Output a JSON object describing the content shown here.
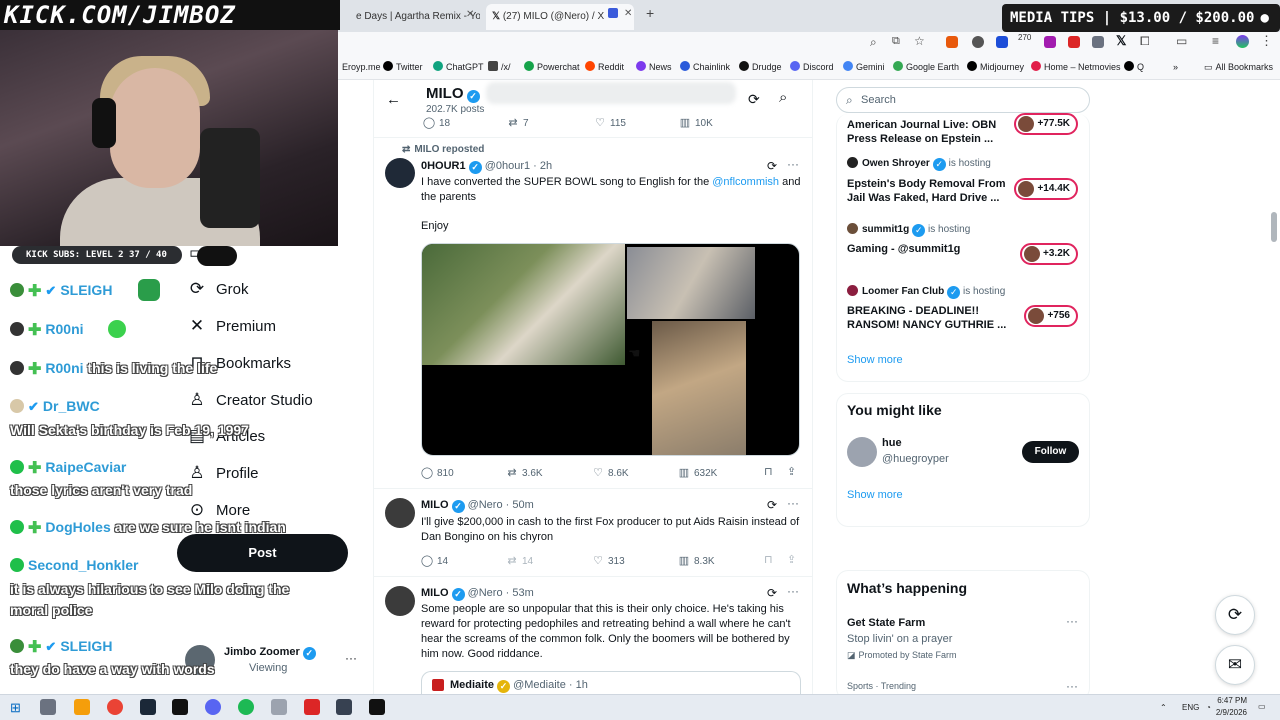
{
  "browser": {
    "tabs": [
      {
        "label": "e Days | Agartha Remix - You"
      },
      {
        "label": "(27) MILO (@Nero) / X",
        "active": true
      }
    ],
    "toolbar_badge": "270",
    "bookmarks": [
      {
        "label": "Eroyp.me",
        "color": "#999999"
      },
      {
        "label": "Twitter",
        "color": "#000000"
      },
      {
        "label": "ChatGPT",
        "color": "#10a37f"
      },
      {
        "label": "/x/",
        "color": "#444444"
      },
      {
        "label": "Powerchat",
        "color": "#16a34a"
      },
      {
        "label": "Reddit",
        "color": "#ff4500"
      },
      {
        "label": "News",
        "color": "#7c3aed"
      },
      {
        "label": "Chainlink",
        "color": "#2a5ada"
      },
      {
        "label": "Drudge",
        "color": "#111111"
      },
      {
        "label": "Discord",
        "color": "#5865f2"
      },
      {
        "label": "Gemini",
        "color": "#4285f4"
      },
      {
        "label": "Google Earth",
        "color": "#34a853"
      },
      {
        "label": "Midjourney",
        "color": "#000000"
      },
      {
        "label": "Home – Netmovies",
        "color": "#e11d48"
      },
      {
        "label": "Q",
        "color": "#000000"
      },
      {
        "label": "»",
        "color": "transparent"
      },
      {
        "label": "All Bookmarks",
        "color": "transparent"
      }
    ]
  },
  "overlay": {
    "stream_logo": "KICK.COM/JIMBOZ",
    "media_tips": "MEDIA TIPS | $13.00 / $200.00",
    "kick_subs": "KICK SUBS: LEVEL 2 37 / 40",
    "chat": [
      {
        "user": "SLEIGH",
        "message": "",
        "badge_color": "#3a8e3a"
      },
      {
        "user": "R00ni",
        "message": "",
        "badge_color": "#333333"
      },
      {
        "user": "R00ni",
        "message": "this is living the life",
        "badge_color": "#333333"
      },
      {
        "user": "Dr_BWC",
        "message": "",
        "badge_color": "#d8c8a8"
      },
      {
        "user": "",
        "message": "Will Sekta's birthday is Feb 19, 1997",
        "badge_color": ""
      },
      {
        "user": "RaipeCaviar",
        "message": "",
        "badge_color": "#1fbf4a"
      },
      {
        "user": "",
        "message": "those lyrics aren't very trad",
        "badge_color": ""
      },
      {
        "user": "DogHoles",
        "message": "are we sure he isnt indian",
        "badge_color": "#1fbf4a"
      },
      {
        "user": "Second_Honkler",
        "message": "",
        "badge_color": "#1fbf4a"
      },
      {
        "user": "",
        "message": "it is always hilarious to see Milo doing the",
        "badge_color": ""
      },
      {
        "user": "",
        "message": "moral police",
        "badge_color": ""
      },
      {
        "user": "SLEIGH",
        "message": "",
        "badge_color": "#3a8e3a"
      },
      {
        "user": "",
        "message": "they do have a way with words",
        "badge_color": ""
      }
    ]
  },
  "x_nav": {
    "items": [
      {
        "label": "at",
        "icon": "chat-icon"
      },
      {
        "label": "Grok",
        "icon": "grok-icon"
      },
      {
        "label": "Premium",
        "icon": "x-logo-icon"
      },
      {
        "label": "Bookmarks",
        "icon": "bookmark-icon"
      },
      {
        "label": "Creator Studio",
        "icon": "creator-studio-icon"
      },
      {
        "label": "Articles",
        "icon": "articles-icon"
      },
      {
        "label": "Profile",
        "icon": "profile-icon"
      },
      {
        "label": "More",
        "icon": "more-icon"
      }
    ],
    "post_label": "Post",
    "account": {
      "name": "Jimbo Zoomer",
      "sub": "Viewing"
    }
  },
  "profile_header": {
    "name": "MILO",
    "posts": "202.7K posts"
  },
  "tweets": [
    {
      "stats": {
        "replies": "18",
        "reposts": "7",
        "likes": "115",
        "views": "10K"
      }
    },
    {
      "repost_label": "MILO reposted",
      "name": "0HOUR1",
      "handle": "@0hour1",
      "time": "2h",
      "text_before": "I have converted the SUPER BOWL song to English for the ",
      "mention": "@nflcommish",
      "text_after": " and the parents",
      "text2": "Enjoy",
      "stats": {
        "replies": "810",
        "reposts": "3.6K",
        "likes": "8.6K",
        "views": "632K"
      }
    },
    {
      "name": "MILO",
      "handle": "@Nero",
      "time": "50m",
      "text": "I'll give $200,000 in cash to the first Fox producer to put Aids Raisin instead of Dan Bongino on his chyron",
      "stats": {
        "replies": "14",
        "reposts": "14",
        "likes": "313",
        "views": "8.3K"
      }
    },
    {
      "name": "MILO",
      "handle": "@Nero",
      "time": "53m",
      "text": "Some people are so unpopular that this is their only choice. He's taking his reward for protecting pedophiles and retreating behind a wall where he can't hear the screams of the common folk. Only the boomers will be bothered by him now. Good riddance.",
      "quote": {
        "name": "Mediaite",
        "handle": "@Mediaite",
        "time": "1h"
      }
    }
  ],
  "sidebar": {
    "search_placeholder": "Search",
    "spaces": [
      {
        "host": "",
        "status": "",
        "title_lines": [
          "American Journal Live: OBN ",
          "Press Release on Epstein ..."
        ],
        "count": "+77.5K"
      },
      {
        "host": "Owen Shroyer",
        "status": "is hosting",
        "title_lines": [
          "Epstein's Body Removal From",
          "Jail Was Faked, Hard Drive ..."
        ],
        "count": "+14.4K"
      },
      {
        "host": "summit1g",
        "status": "is hosting",
        "title_lines": [
          "Gaming - @summit1g"
        ],
        "count": "+3.2K"
      },
      {
        "host": "Loomer Fan Club",
        "status": "is hosting",
        "title_lines": [
          "BREAKING - DEADLINE!!",
          "RANSOM! NANCY GUTHRIE ..."
        ],
        "count": "+756"
      }
    ],
    "show_more": "Show more",
    "you_might_like": {
      "title": "You might like",
      "user": {
        "name": "hue",
        "handle": "@huegroyper"
      },
      "follow_label": "Follow",
      "show_more": "Show more"
    },
    "whats_happening": {
      "title": "What’s happening",
      "items": [
        {
          "title": "Get State Farm",
          "desc": "Stop livin' on a prayer",
          "promo": "Promoted by State Farm"
        },
        {
          "title": "Sports · Trending",
          "desc": "",
          "promo": ""
        }
      ]
    }
  },
  "taskbar": {
    "lang": "ENG",
    "time": "6:47 PM",
    "date": "2/9/2026"
  }
}
